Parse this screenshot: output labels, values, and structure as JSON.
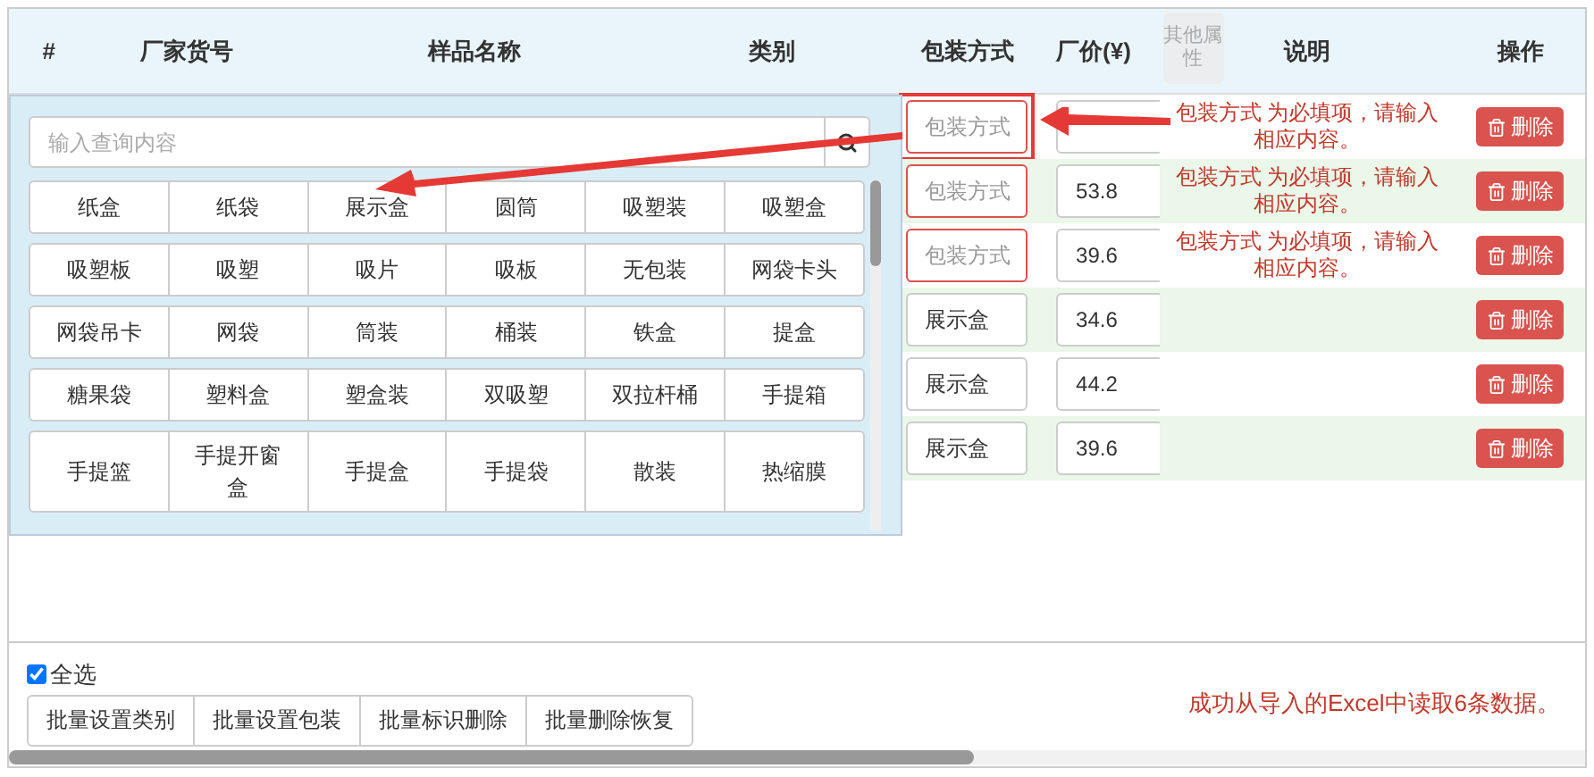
{
  "table": {
    "columns": [
      "#",
      "厂家货号",
      "样品名称",
      "类别",
      "包装方式",
      "厂价(¥)",
      "说明",
      "操作"
    ],
    "other_attributes_button": "其他属性",
    "rows": [
      {
        "package": {
          "placeholder": "包装方式"
        },
        "invalid": true,
        "highlighted": true,
        "price": "",
        "note": "包装方式 为必填项，请输入相应内容。",
        "delete": "删除"
      },
      {
        "package": {
          "placeholder": "包装方式"
        },
        "invalid": true,
        "highlighted": false,
        "price": "53.8",
        "note": "包装方式 为必填项，请输入相应内容。",
        "delete": "删除"
      },
      {
        "package": {
          "placeholder": "包装方式"
        },
        "invalid": true,
        "highlighted": false,
        "price": "39.6",
        "note": "包装方式 为必填项，请输入相应内容。",
        "delete": "删除"
      },
      {
        "package": {
          "value": "展示盒"
        },
        "invalid": false,
        "highlighted": false,
        "price": "34.6",
        "note": "",
        "delete": "删除"
      },
      {
        "package": {
          "value": "展示盒"
        },
        "invalid": false,
        "highlighted": false,
        "price": "44.2",
        "note": "",
        "delete": "删除"
      },
      {
        "package": {
          "value": "展示盒"
        },
        "invalid": false,
        "highlighted": false,
        "price": "39.6",
        "note": "",
        "delete": "删除"
      }
    ]
  },
  "dropdown": {
    "search": {
      "placeholder": "输入查询内容"
    },
    "options": [
      [
        "纸盒",
        "纸袋",
        "展示盒",
        "圆筒",
        "吸塑装",
        "吸塑盒"
      ],
      [
        "吸塑板",
        "吸塑",
        "吸片",
        "吸板",
        "无包装",
        "网袋卡头"
      ],
      [
        "网袋吊卡",
        "网袋",
        "筒装",
        "桶装",
        "铁盒",
        "提盒"
      ],
      [
        "糖果袋",
        "塑料盒",
        "塑盒装",
        "双吸塑",
        "双拉杆桶",
        "手提箱"
      ],
      [
        "手提篮",
        "手提开窗盒",
        "手提盒",
        "手提袋",
        "散装",
        "热缩膜"
      ]
    ]
  },
  "select_all": {
    "label": "全选",
    "checked": true
  },
  "batch_buttons": [
    "批量设置类别",
    "批量设置包装",
    "批量标识删除",
    "批量删除恢复"
  ],
  "status_message": "成功从导入的Excel中读取6条数据。"
}
